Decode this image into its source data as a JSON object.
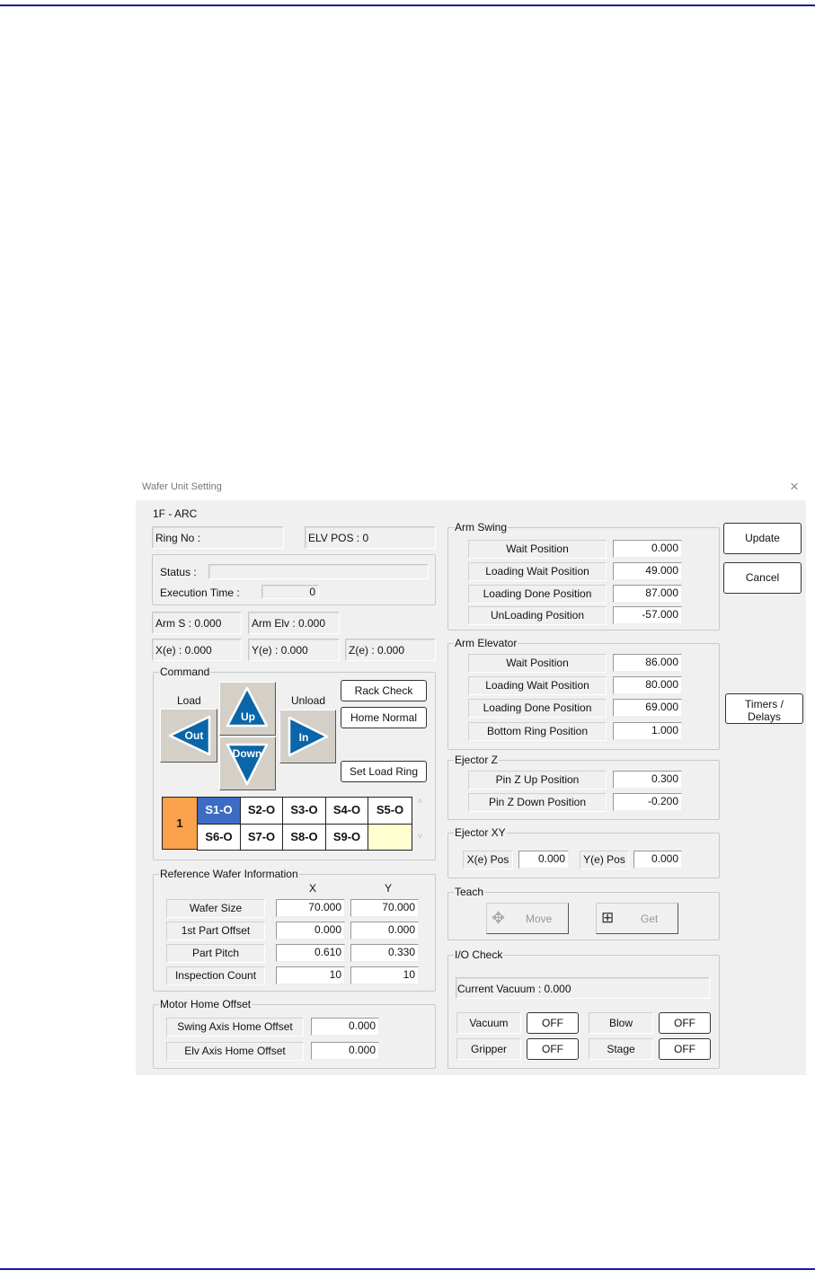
{
  "window": {
    "title": "Wafer Unit Setting",
    "close": "×"
  },
  "header": {
    "unit": "1F - ARC",
    "ring_no": "Ring No :",
    "elv_pos": "ELV POS : 0"
  },
  "status": {
    "status_label": "Status :",
    "status_value": "",
    "exec_label": "Execution Time :",
    "exec_value": "0"
  },
  "positions": {
    "arm_s": "Arm S : 0.000",
    "arm_elv": "Arm Elv : 0.000",
    "xe": "X(e) : 0.000",
    "ye": "Y(e) : 0.000",
    "ze": "Z(e) : 0.000"
  },
  "command": {
    "title": "Command",
    "load": "Load",
    "unload": "Unload",
    "out": "Out",
    "up": "Up",
    "down": "Down",
    "in": "In",
    "rack_check": "Rack Check",
    "home_normal": "Home Normal",
    "set_load_ring": "Set Load Ring",
    "ring_index": "1",
    "slots": [
      "S1-O",
      "S2-O",
      "S3-O",
      "S4-O",
      "S5-O",
      "S6-O",
      "S7-O",
      "S8-O",
      "S9-O",
      ""
    ],
    "selected_slot": "S1-O",
    "colors": {
      "index": "#f9a24b",
      "selected": "#3c6cc4",
      "empty": "#ffffd0",
      "arrow": "#0a66a8"
    }
  },
  "reference": {
    "title": "Reference Wafer Information",
    "col_x": "X",
    "col_y": "Y",
    "rows": [
      {
        "label": "Wafer Size",
        "x": "70.000",
        "y": "70.000"
      },
      {
        "label": "1st Part Offset",
        "x": "0.000",
        "y": "0.000"
      },
      {
        "label": "Part Pitch",
        "x": "0.610",
        "y": "0.330"
      },
      {
        "label": "Inspection Count",
        "x": "10",
        "y": "10"
      }
    ]
  },
  "motor": {
    "title": "Motor Home Offset",
    "rows": [
      {
        "label": "Swing Axis Home Offset",
        "value": "0.000"
      },
      {
        "label": "Elv Axis Home Offset",
        "value": "0.000"
      }
    ]
  },
  "arm_swing": {
    "title": "Arm Swing",
    "rows": [
      {
        "label": "Wait Position",
        "value": "0.000"
      },
      {
        "label": "Loading Wait Position",
        "value": "49.000"
      },
      {
        "label": "Loading Done Position",
        "value": "87.000"
      },
      {
        "label": "UnLoading Position",
        "value": "-57.000"
      }
    ]
  },
  "arm_elevator": {
    "title": "Arm Elevator",
    "rows": [
      {
        "label": "Wait Position",
        "value": "86.000"
      },
      {
        "label": "Loading Wait Position",
        "value": "80.000"
      },
      {
        "label": "Loading Done Position",
        "value": "69.000"
      },
      {
        "label": "Bottom Ring Position",
        "value": "1.000"
      }
    ]
  },
  "ejector_z": {
    "title": "Ejector Z",
    "rows": [
      {
        "label": "Pin Z Up Position",
        "value": "0.300"
      },
      {
        "label": "Pin Z Down Position",
        "value": "-0.200"
      }
    ]
  },
  "ejector_xy": {
    "title": "Ejector XY",
    "x_label": "X(e) Pos",
    "x_value": "0.000",
    "y_label": "Y(e) Pos",
    "y_value": "0.000"
  },
  "teach": {
    "title": "Teach",
    "move": "Move",
    "get": "Get"
  },
  "io": {
    "title": "I/O Check",
    "current_vacuum": "Current Vacuum : 0.000",
    "items": [
      {
        "label": "Vacuum",
        "state": "OFF"
      },
      {
        "label": "Blow",
        "state": "OFF"
      },
      {
        "label": "Gripper",
        "state": "OFF"
      },
      {
        "label": "Stage",
        "state": "OFF"
      }
    ]
  },
  "actions": {
    "update": "Update",
    "cancel": "Cancel",
    "timers": "Timers /",
    "delays": "Delays"
  }
}
